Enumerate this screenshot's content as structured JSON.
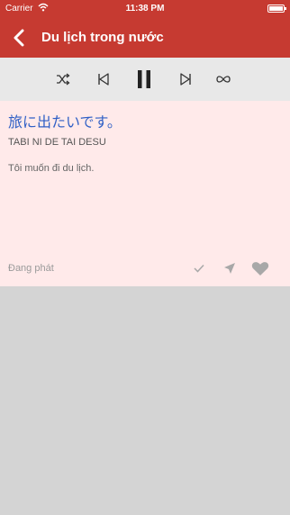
{
  "status_bar": {
    "carrier": "Carrier",
    "time": "11:38 PM"
  },
  "header": {
    "title": "Du lịch trong nước",
    "back_icon": "chevron-left-icon"
  },
  "player": {
    "buttons": [
      "shuffle-icon",
      "previous-icon",
      "pause-icon",
      "next-icon",
      "repeat-icon"
    ]
  },
  "phrase": {
    "japanese": "旅に出たいです。",
    "romaji": "TABI NI DE TAI DESU",
    "meaning": "Tôi muốn đi du lịch."
  },
  "footer": {
    "status": "Đang phát",
    "actions": [
      "check-icon",
      "send-icon",
      "heart-icon"
    ]
  },
  "colors": {
    "header": "#c63a31",
    "card": "#ffeaea",
    "japanese_text": "#3060c6",
    "background": "#d4d4d4"
  }
}
